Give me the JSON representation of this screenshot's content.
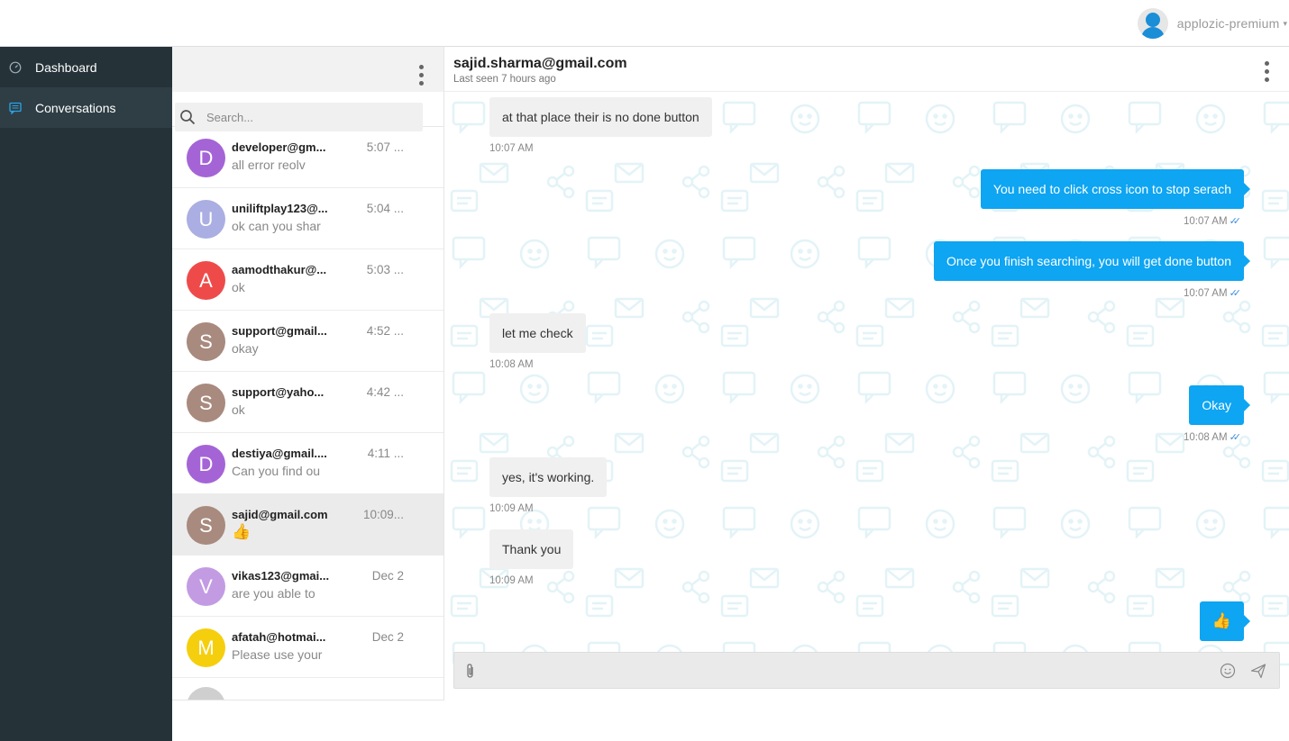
{
  "topbar": {
    "user_name": "applozic-premium",
    "caret": "▾"
  },
  "sidebar": {
    "items": [
      {
        "label": "Dashboard",
        "icon": "speedometer-icon",
        "active": false
      },
      {
        "label": "Conversations",
        "icon": "chat-icon",
        "active": true
      }
    ]
  },
  "conversation_list": {
    "search_placeholder": "Search...",
    "items": [
      {
        "initial": "D",
        "color": "#a464d6",
        "name": "developer@gm...",
        "time": "5:07 ...",
        "preview": "all error reolv"
      },
      {
        "initial": "U",
        "color": "#aaaee2",
        "name": "uniliftplay123@...",
        "time": "5:04 ...",
        "preview": "ok can you shar"
      },
      {
        "initial": "A",
        "color": "#ef4a4a",
        "name": "aamodthakur@...",
        "time": "5:03 ...",
        "preview": "ok"
      },
      {
        "initial": "S",
        "color": "#a88a7e",
        "name": "support@gmail...",
        "time": "4:52 ...",
        "preview": "okay"
      },
      {
        "initial": "S",
        "color": "#a88a7e",
        "name": "support@yaho...",
        "time": "4:42 ...",
        "preview": "ok"
      },
      {
        "initial": "D",
        "color": "#a464d6",
        "name": "destiya@gmail....",
        "time": "4:11 ...",
        "preview": "Can you find ou"
      },
      {
        "initial": "S",
        "color": "#a88a7e",
        "name": "sajid@gmail.com",
        "time": "10:09...",
        "preview": "👍",
        "selected": true
      },
      {
        "initial": "V",
        "color": "#c39be3",
        "name": "vikas123@gmai...",
        "time": "Dec 2",
        "preview": "are you able to"
      },
      {
        "initial": "M",
        "color": "#f5cf0e",
        "name": "afatah@hotmai...",
        "time": "Dec 2",
        "preview": "Please use your"
      }
    ]
  },
  "chat": {
    "title": "sajid.sharma@gmail.com",
    "subtitle": "Last seen 7 hours ago",
    "messages": [
      {
        "dir": "in",
        "text": "at that place their is no done button",
        "time": "10:07 AM"
      },
      {
        "dir": "out",
        "text": "You need to click cross icon to stop serach",
        "time": "10:07 AM",
        "ticks": "✓✓"
      },
      {
        "dir": "out",
        "text": "Once you finish searching, you will get done button",
        "time": "10:07 AM",
        "ticks": "✓✓"
      },
      {
        "dir": "in",
        "text": "let me check",
        "time": "10:08 AM"
      },
      {
        "dir": "out",
        "text": "Okay",
        "time": "10:08 AM",
        "ticks": "✓✓"
      },
      {
        "dir": "in",
        "text": "yes, it's working.",
        "time": "10:09 AM"
      },
      {
        "dir": "in",
        "text": "Thank you",
        "time": "10:09 AM"
      },
      {
        "dir": "out",
        "text": "👍",
        "time": "",
        "ticks": ""
      }
    ],
    "composer_placeholder": ""
  },
  "colors": {
    "sidebar_bg": "#253238",
    "sidebar_active": "#2f3e45",
    "outgoing_bubble": "#0ea5f2",
    "incoming_bubble": "#f0f0f0",
    "read_ticks": "#3f8ee0"
  }
}
